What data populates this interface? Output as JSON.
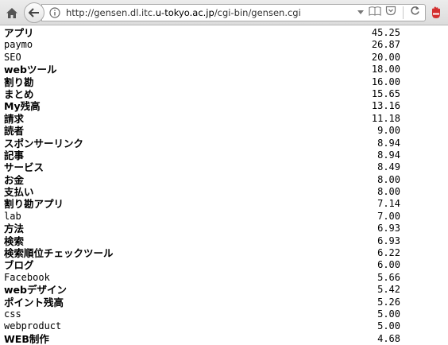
{
  "browser": {
    "url_prefix": "http://gensen.dl.itc.",
    "url_host": "u-tokyo.ac.jp",
    "url_suffix": "/cgi-bin/gensen.cgi",
    "icons": {
      "home": "home-icon",
      "back": "back-arrow-icon",
      "info": "info-icon",
      "dropdown": "dropdown-arrow-icon",
      "reader": "reader-view-icon",
      "pocket": "pocket-icon",
      "reload": "reload-icon",
      "adblock": "adblock-icon"
    }
  },
  "terms": [
    {
      "term": "アプリ",
      "score": "45.25",
      "ja": true
    },
    {
      "term": "paymo",
      "score": "26.87",
      "ja": false
    },
    {
      "term": "SEO",
      "score": "20.00",
      "ja": false
    },
    {
      "term": "webツール",
      "score": "18.00",
      "ja": true
    },
    {
      "term": "割り勘",
      "score": "16.00",
      "ja": true
    },
    {
      "term": "まとめ",
      "score": "15.65",
      "ja": true
    },
    {
      "term": "My残高",
      "score": "13.16",
      "ja": true
    },
    {
      "term": "請求",
      "score": "11.18",
      "ja": true
    },
    {
      "term": "読者",
      "score": "9.00",
      "ja": true
    },
    {
      "term": "スポンサーリンク",
      "score": "8.94",
      "ja": true
    },
    {
      "term": "記事",
      "score": "8.94",
      "ja": true
    },
    {
      "term": "サービス",
      "score": "8.49",
      "ja": true
    },
    {
      "term": "お金",
      "score": "8.00",
      "ja": true
    },
    {
      "term": "支払い",
      "score": "8.00",
      "ja": true
    },
    {
      "term": "割り勘アプリ",
      "score": "7.14",
      "ja": true
    },
    {
      "term": "lab",
      "score": "7.00",
      "ja": false
    },
    {
      "term": "方法",
      "score": "6.93",
      "ja": true
    },
    {
      "term": "検索",
      "score": "6.93",
      "ja": true
    },
    {
      "term": "検索順位チェックツール",
      "score": "6.22",
      "ja": true
    },
    {
      "term": "ブログ",
      "score": "6.00",
      "ja": true
    },
    {
      "term": "Facebook",
      "score": "5.66",
      "ja": false
    },
    {
      "term": "webデザイン",
      "score": "5.42",
      "ja": true
    },
    {
      "term": "ポイント残高",
      "score": "5.26",
      "ja": true
    },
    {
      "term": "css",
      "score": "5.00",
      "ja": false
    },
    {
      "term": "webproduct",
      "score": "5.00",
      "ja": false
    },
    {
      "term": "WEB制作",
      "score": "4.68",
      "ja": true
    }
  ]
}
